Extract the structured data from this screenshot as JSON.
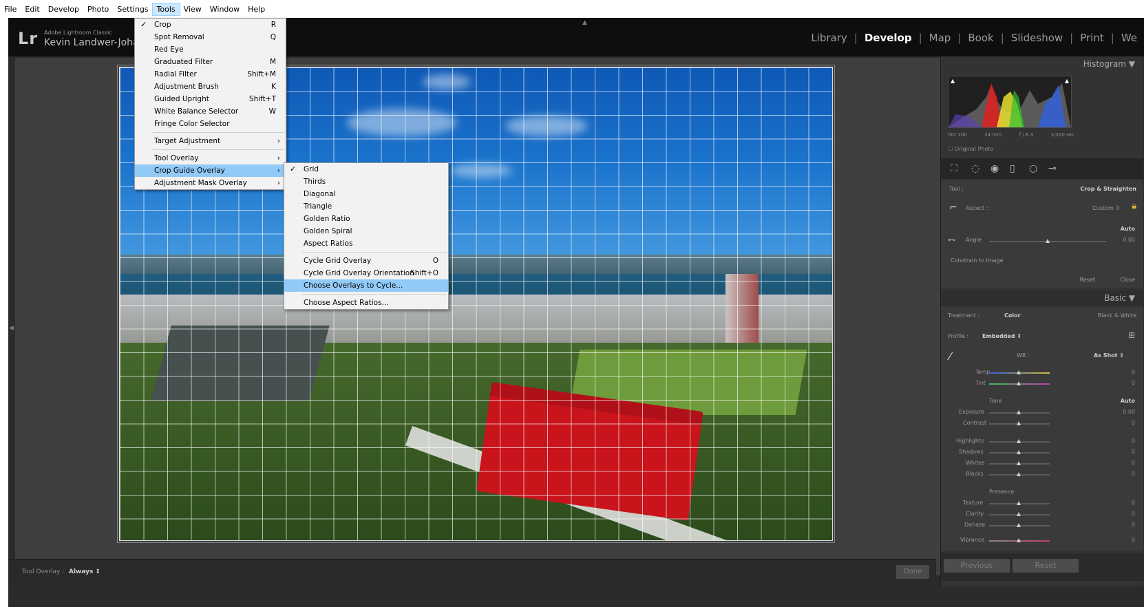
{
  "menubar": [
    "File",
    "Edit",
    "Develop",
    "Photo",
    "Settings",
    "Tools",
    "View",
    "Window",
    "Help"
  ],
  "identity": {
    "logo": "Lr",
    "product": "Adobe Lightroom Classic",
    "user": "Kevin Landwer-Johan"
  },
  "modules": [
    "Library",
    "Develop",
    "Map",
    "Book",
    "Slideshow",
    "Print",
    "We"
  ],
  "tools_menu": {
    "crop": {
      "label": "Crop",
      "shortcut": "R",
      "check": "✓"
    },
    "spot": {
      "label": "Spot Removal",
      "shortcut": "Q"
    },
    "redeye": {
      "label": "Red Eye"
    },
    "graduated": {
      "label": "Graduated Filter",
      "shortcut": "M"
    },
    "radial": {
      "label": "Radial Filter",
      "shortcut": "Shift+M"
    },
    "brush": {
      "label": "Adjustment Brush",
      "shortcut": "K"
    },
    "upright": {
      "label": "Guided Upright",
      "shortcut": "Shift+T"
    },
    "wb": {
      "label": "White Balance Selector",
      "shortcut": "W"
    },
    "fringe": {
      "label": "Fringe Color Selector"
    },
    "target": {
      "label": "Target Adjustment"
    },
    "tooloverlay": {
      "label": "Tool Overlay"
    },
    "cropguide": {
      "label": "Crop Guide Overlay"
    },
    "maskoverlay": {
      "label": "Adjustment Mask Overlay"
    }
  },
  "overlay_menu": {
    "grid": {
      "label": "Grid",
      "check": "✓"
    },
    "thirds": {
      "label": "Thirds"
    },
    "diagonal": {
      "label": "Diagonal"
    },
    "triangle": {
      "label": "Triangle"
    },
    "golden_ratio": {
      "label": "Golden Ratio"
    },
    "golden_spiral": {
      "label": "Golden Spiral"
    },
    "aspect_ratios": {
      "label": "Aspect Ratios"
    },
    "cycle": {
      "label": "Cycle Grid Overlay",
      "shortcut": "O"
    },
    "cycle_orient": {
      "label": "Cycle Grid Overlay Orientation",
      "shortcut": "Shift+O"
    },
    "choose_overlays": {
      "label": "Choose Overlays to Cycle..."
    },
    "choose_aspect": {
      "label": "Choose Aspect Ratios..."
    }
  },
  "toolbar": {
    "label": "Tool Overlay :",
    "value": "Always ⇕",
    "done": "Done"
  },
  "panel": {
    "histogram_title": "Histogram ▼",
    "histo_meta": [
      "ISO 100",
      "24 mm",
      "f / 6.3",
      "1/320 sec"
    ],
    "original_photo": "☐ Original Photo",
    "crop": {
      "tool_label": "Tool :",
      "tool_value": "Crop & Straighten",
      "aspect_label": "Aspect :",
      "aspect_value": "Custom ⇕",
      "auto": "Auto",
      "angle_label": "Angle",
      "angle_value": "0.00",
      "constrain": "Constrain to Image",
      "reset": "Reset",
      "close": "Close"
    },
    "basic": {
      "title": "Basic ▼",
      "treatment_label": "Treatment :",
      "treatment_color": "Color",
      "treatment_bw": "Black & White",
      "profile_label": "Profile :",
      "profile_value": "Embedded ⇕",
      "wb_label": "WB :",
      "wb_value": "As Shot ⇕",
      "temp": "Temp",
      "tint": "Tint",
      "tone": "Tone",
      "tone_auto": "Auto",
      "exposure": "Exposure",
      "exposure_val": "0.00",
      "contrast": "Contrast",
      "highlights": "Highlights",
      "shadows": "Shadows",
      "whites": "Whites",
      "blacks": "Blacks",
      "presence": "Presence",
      "texture": "Texture",
      "clarity": "Clarity",
      "dehaze": "Dehaze",
      "vibrance": "Vibrance",
      "zero": "0"
    },
    "previous": "Previous",
    "reset": "Reset"
  },
  "colors": {
    "menu_highlight": "#91c9f7",
    "panel_bg": "#333333",
    "tram_red": "#c9141c"
  }
}
